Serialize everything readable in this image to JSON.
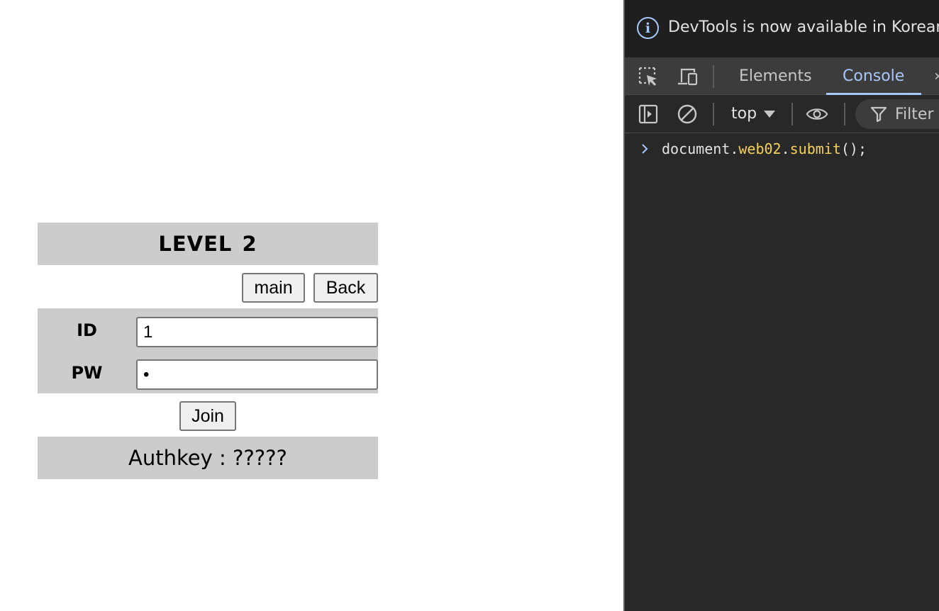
{
  "page": {
    "title": "LEVEL 2",
    "nav": {
      "main_label": "main",
      "back_label": "Back"
    },
    "form": {
      "id_label": "ID",
      "id_value": "1",
      "pw_label": "PW",
      "pw_value": "•",
      "join_label": "Join"
    },
    "authkey": "Authkey : ?????"
  },
  "devtools": {
    "info_text": "DevTools is now available in Korean",
    "tabs": [
      {
        "label": "Elements",
        "active": false
      },
      {
        "label": "Console",
        "active": true
      }
    ],
    "toolbar": {
      "context": "top",
      "filter_placeholder": "Filter"
    },
    "console": {
      "tokens": {
        "obj": "document",
        "dot1": ".",
        "prop1": "web02",
        "dot2": ".",
        "prop2": "submit",
        "tail": "();"
      }
    },
    "colors": {
      "accent": "#a8c7fa",
      "console_property": "#f5d15a",
      "panel_bg": "#282828",
      "tabbar_bg": "#3c3c3c"
    }
  },
  "icons": [
    "info-icon",
    "inspect-element-icon",
    "device-toolbar-icon",
    "sidebar-toggle-icon",
    "clear-console-icon",
    "eye-icon",
    "filter-icon",
    "chevron-right-icon"
  ]
}
